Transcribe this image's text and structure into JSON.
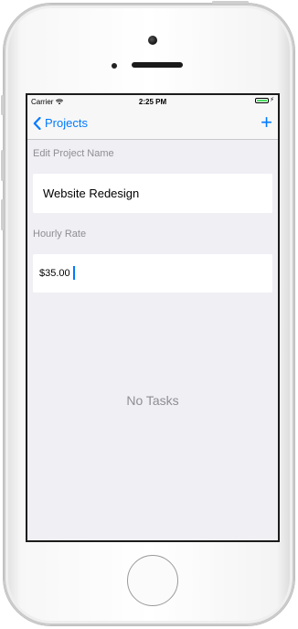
{
  "status_bar": {
    "carrier": "Carrier",
    "time": "2:25 PM",
    "battery_level": 1.0,
    "battery_color": "#4cd964"
  },
  "nav": {
    "back_label": "Projects",
    "add_label": "+",
    "tint": "#007aff"
  },
  "form": {
    "name_section_label": "Edit Project Name",
    "name_value": "Website Redesign",
    "rate_section_label": "Hourly Rate",
    "rate_value": "$35.00"
  },
  "tasks": {
    "empty_label": "No Tasks"
  },
  "icons": [
    "wifi-icon",
    "battery-icon",
    "chevron-left-icon",
    "plus-icon"
  ]
}
